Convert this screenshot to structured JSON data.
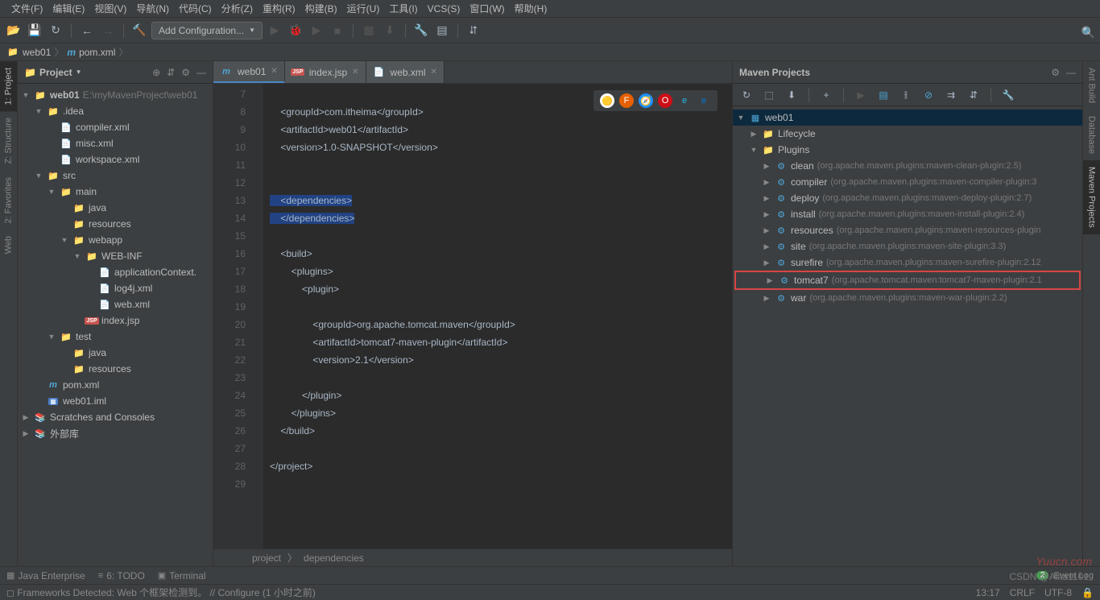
{
  "menu": [
    "文件(F)",
    "编辑(E)",
    "视图(V)",
    "导航(N)",
    "代码(C)",
    "分析(Z)",
    "重构(R)",
    "构建(B)",
    "运行(U)",
    "工具(I)",
    "VCS(S)",
    "窗口(W)",
    "帮助(H)"
  ],
  "config": "Add Configuration...",
  "breadcrumb": {
    "root": "web01",
    "file": "pom.xml"
  },
  "project": {
    "title": "Project",
    "tree": [
      {
        "d": 0,
        "a": "▼",
        "i": "dir",
        "n": "web01",
        "suf": " E:\\myMavenProject\\web01",
        "bold": true
      },
      {
        "d": 1,
        "a": "▼",
        "i": "dir",
        "n": ".idea"
      },
      {
        "d": 2,
        "a": "",
        "i": "xml",
        "n": "compiler.xml"
      },
      {
        "d": 2,
        "a": "",
        "i": "xml",
        "n": "misc.xml"
      },
      {
        "d": 2,
        "a": "",
        "i": "xml",
        "n": "workspace.xml"
      },
      {
        "d": 1,
        "a": "▼",
        "i": "dir",
        "n": "src"
      },
      {
        "d": 2,
        "a": "▼",
        "i": "dir",
        "n": "main"
      },
      {
        "d": 3,
        "a": "",
        "i": "javadir",
        "n": "java"
      },
      {
        "d": 3,
        "a": "",
        "i": "resdir",
        "n": "resources"
      },
      {
        "d": 3,
        "a": "▼",
        "i": "dir",
        "n": "webapp"
      },
      {
        "d": 4,
        "a": "▼",
        "i": "dir",
        "n": "WEB-INF"
      },
      {
        "d": 5,
        "a": "",
        "i": "xml",
        "n": "applicationContext."
      },
      {
        "d": 5,
        "a": "",
        "i": "xml",
        "n": "log4j.xml"
      },
      {
        "d": 5,
        "a": "",
        "i": "xml",
        "n": "web.xml"
      },
      {
        "d": 4,
        "a": "",
        "i": "jsp",
        "n": "index.jsp"
      },
      {
        "d": 2,
        "a": "▼",
        "i": "dir",
        "n": "test"
      },
      {
        "d": 3,
        "a": "",
        "i": "javadir",
        "n": "java"
      },
      {
        "d": 3,
        "a": "",
        "i": "resdir",
        "n": "resources"
      },
      {
        "d": 1,
        "a": "",
        "i": "mvn",
        "n": "pom.xml"
      },
      {
        "d": 1,
        "a": "",
        "i": "mod",
        "n": "web01.iml"
      },
      {
        "d": 0,
        "a": "▶",
        "i": "lib",
        "n": "Scratches and Consoles"
      },
      {
        "d": 0,
        "a": "▶",
        "i": "lib",
        "n": "外部库"
      }
    ]
  },
  "tabs": [
    {
      "i": "mvn",
      "n": "web01",
      "active": true
    },
    {
      "i": "jsp",
      "n": "index.jsp"
    },
    {
      "i": "xml",
      "n": "web.xml"
    }
  ],
  "lines": [
    7,
    8,
    9,
    10,
    11,
    12,
    13,
    14,
    15,
    16,
    17,
    18,
    19,
    20,
    21,
    22,
    23,
    24,
    25,
    26,
    27,
    28,
    29
  ],
  "code": [
    "",
    "    <groupId>com.itheima</groupId>",
    "    <artifactId>web01</artifactId>",
    "    <version>1.0-SNAPSHOT</version>",
    "",
    "",
    "    <dependencies>",
    "    </dependencies>",
    "",
    "    <build>",
    "        <plugins>",
    "            <plugin>",
    "",
    "                <groupId>org.apache.tomcat.maven</groupId>",
    "                <artifactId>tomcat7-maven-plugin</artifactId>",
    "                <version>2.1</version>",
    "",
    "            </plugin>",
    "        </plugins>",
    "    </build>",
    "",
    "</project>",
    ""
  ],
  "crumb": {
    "a": "project",
    "b": "dependencies"
  },
  "maven": {
    "title": "Maven Projects",
    "root": "web01",
    "lifecycle": "Lifecycle",
    "plugins": "Plugins",
    "items": [
      {
        "n": "clean",
        "c": "(org.apache.maven.plugins:maven-clean-plugin:2.5)"
      },
      {
        "n": "compiler",
        "c": "(org.apache.maven.plugins:maven-compiler-plugin:3"
      },
      {
        "n": "deploy",
        "c": "(org.apache.maven.plugins:maven-deploy-plugin:2.7)"
      },
      {
        "n": "install",
        "c": "(org.apache.maven.plugins:maven-install-plugin:2.4)"
      },
      {
        "n": "resources",
        "c": "(org.apache.maven.plugins:maven-resources-plugin"
      },
      {
        "n": "site",
        "c": "(org.apache.maven.plugins:maven-site-plugin:3.3)"
      },
      {
        "n": "surefire",
        "c": "(org.apache.maven.plugins:maven-surefire-plugin:2.12"
      },
      {
        "n": "tomcat7",
        "c": "(org.apache.tomcat.maven:tomcat7-maven-plugin:2.1",
        "hl": true
      },
      {
        "n": "war",
        "c": "(org.apache.maven.plugins:maven-war-plugin:2.2)"
      }
    ]
  },
  "leftTabs": [
    "1: Project",
    "Z: Structure",
    "2: Favorites",
    "Web"
  ],
  "rightTabs": [
    "Ant Build",
    "Database",
    "Maven Projects"
  ],
  "botTabs": [
    "Java Enterprise",
    "6: TODO",
    "Terminal"
  ],
  "eventLog": "Event Log",
  "status": {
    "msg": "Frameworks Detected: Web 个框架检测到。 // Configure (1 小时之前)",
    "time": "13:17",
    "sep": "CRLF",
    "enc": "UTF-8"
  },
  "watermark": "Yuucn.com",
  "csdn": "CSDN @Alita1101"
}
